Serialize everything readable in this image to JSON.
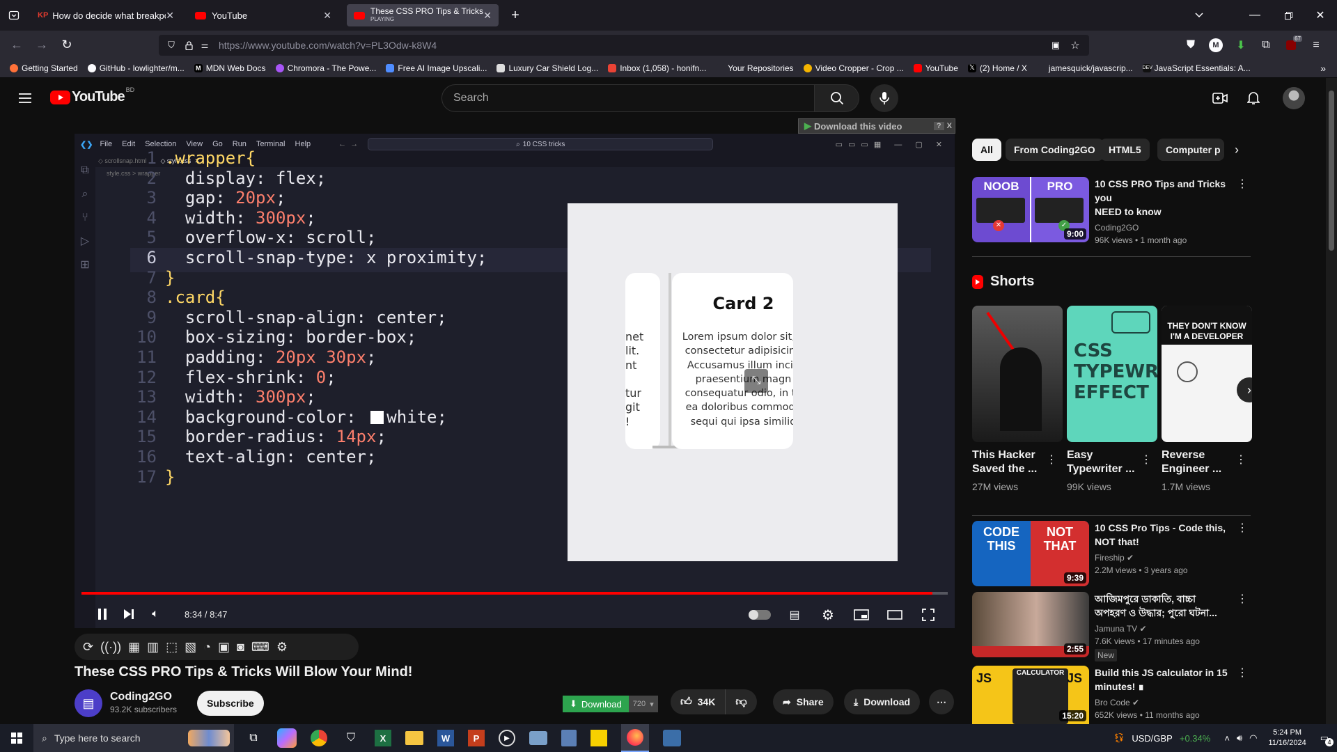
{
  "browser": {
    "tabs": [
      {
        "label": "How do decide what breakpoin",
        "icon": "kp-icon",
        "active": false
      },
      {
        "label": "YouTube",
        "icon": "youtube-icon",
        "active": false
      },
      {
        "label": "These CSS PRO Tips & Tricks W",
        "sub": "PLAYING",
        "icon": "youtube-icon",
        "active": true
      }
    ],
    "url": "https://www.youtube.com/watch?v=PL3Odw-k8W4",
    "extension_badge": "67",
    "bookmarks": [
      "Getting Started",
      "GitHub - lowlighter/m...",
      "MDN Web Docs",
      "Chromora - The Powe...",
      "Free AI Image Upscali...",
      "Luxury Car Shield Log...",
      "Inbox (1,058) - honifn...",
      "Your Repositories",
      "Video Cropper - Crop ...",
      "YouTube",
      "(2) Home / X",
      "jamesquick/javascrip...",
      "JavaScript Essentials: A..."
    ]
  },
  "youtube": {
    "logo_text": "YouTube",
    "region": "BD",
    "search_placeholder": "Search",
    "download_banner": "Download this video",
    "download_banner_help": "?",
    "download_banner_close": "X"
  },
  "video": {
    "editor_menu": [
      "File",
      "Edit",
      "Selection",
      "View",
      "Go",
      "Run",
      "Terminal",
      "Help"
    ],
    "command_center": "10 CSS tricks",
    "editor_tabs": [
      "scrollsnap.html",
      "style.css"
    ],
    "breadcrumb": "style.css > wrapper",
    "code_lines": [
      {
        "n": "1",
        "parts": [
          [
            ".wrapper",
            "kw"
          ],
          [
            "{",
            "br"
          ]
        ]
      },
      {
        "n": "2",
        "parts": [
          [
            "  display: flex;",
            ""
          ]
        ]
      },
      {
        "n": "3",
        "parts": [
          [
            "  gap: ",
            ""
          ],
          [
            "20px",
            "num"
          ],
          [
            ";",
            ""
          ]
        ]
      },
      {
        "n": "4",
        "parts": [
          [
            "  width: ",
            ""
          ],
          [
            "300px",
            "num"
          ],
          [
            ";",
            ""
          ]
        ]
      },
      {
        "n": "5",
        "parts": [
          [
            "  overflow-x: scroll;",
            ""
          ]
        ]
      },
      {
        "n": "6",
        "parts": [
          [
            "  scroll-snap-type: x proximity;",
            ""
          ]
        ]
      },
      {
        "n": "7",
        "parts": [
          [
            "}",
            "br"
          ]
        ]
      },
      {
        "n": "8",
        "parts": [
          [
            ".card",
            "kw"
          ],
          [
            "{",
            "br"
          ]
        ]
      },
      {
        "n": "9",
        "parts": [
          [
            "  scroll-snap-align: center;",
            ""
          ]
        ]
      },
      {
        "n": "10",
        "parts": [
          [
            "  box-sizing: border-box;",
            ""
          ]
        ]
      },
      {
        "n": "11",
        "parts": [
          [
            "  padding: ",
            ""
          ],
          [
            "20px 30px",
            "num"
          ],
          [
            ";",
            ""
          ]
        ]
      },
      {
        "n": "12",
        "parts": [
          [
            "  flex-shrink: ",
            ""
          ],
          [
            "0",
            "num"
          ],
          [
            ";",
            ""
          ]
        ]
      },
      {
        "n": "13",
        "parts": [
          [
            "  width: ",
            ""
          ],
          [
            "300px",
            "num"
          ],
          [
            ";",
            ""
          ]
        ]
      },
      {
        "n": "14",
        "parts": [
          [
            "  background-color: ",
            ""
          ],
          [
            "  ",
            "swatch"
          ],
          [
            "white;",
            ""
          ]
        ]
      },
      {
        "n": "15",
        "parts": [
          [
            "  border-radius: ",
            ""
          ],
          [
            "14px",
            "num"
          ],
          [
            ";",
            ""
          ]
        ]
      },
      {
        "n": "16",
        "parts": [
          [
            "  text-align: center;",
            ""
          ]
        ]
      },
      {
        "n": "17",
        "parts": [
          [
            "}",
            "br"
          ]
        ]
      }
    ],
    "preview": {
      "card_title": "Card 2",
      "card_lines": [
        "Lorem ipsum dolor sit, a",
        "consectetur adipisicing",
        "Accusamus illum incid",
        "praesentium magn",
        "consequatur odio, in te",
        "ea doloribus commodi,",
        "sequi qui ipsa similiq"
      ],
      "prev_card_fragments": [
        "net",
        "lit.",
        "nt",
        "",
        "tur",
        "git",
        "!"
      ]
    },
    "time": "8:34 / 8:47",
    "progress": 0.982
  },
  "below": {
    "title": "These CSS PRO Tips & Tricks Will Blow Your Mind!",
    "channel": "Coding2GO",
    "subscribers": "93.2K subscribers",
    "subscribe": "Subscribe",
    "download_green": "Download",
    "quality": "720",
    "likes": "34K",
    "share": "Share",
    "download": "Download"
  },
  "sidebar": {
    "chips": [
      "All",
      "From Coding2GO",
      "HTML5",
      "Computer p"
    ],
    "top_video": {
      "title_1": "10 CSS PRO Tips and Tricks you",
      "title_2": "NEED to know",
      "channel": "Coding2GO",
      "meta": "96K views • 1 month ago",
      "duration": "9:00",
      "thumb_left": "NOOB",
      "thumb_right": "PRO"
    },
    "shorts_heading": "Shorts",
    "shorts": [
      {
        "title_1": "This Hacker",
        "title_2": "Saved the ...",
        "views": "27M views"
      },
      {
        "title_1": "Easy",
        "title_2": "Typewriter ...",
        "views": "99K views",
        "thumb_text": "CSS TYPEWRITER EFFECT"
      },
      {
        "title_1": "Reverse",
        "title_2": "Engineer ...",
        "views": "1.7M views",
        "thumb_text": "THEY DON'T KNOW I'M A DEVELOPER"
      }
    ],
    "videos": [
      {
        "title_1": "10 CSS Pro Tips - Code this,",
        "title_2": "NOT that!",
        "channel": "Fireship",
        "meta": "2.2M views • 3 years ago",
        "duration": "9:39",
        "badge": "",
        "thumb_a": "CODE THIS",
        "thumb_b": "NOT THAT"
      },
      {
        "title_1": "আজিমপুরে ডাকাতি, বাচ্চা",
        "title_2": "অপহরণ ও উদ্ধার; পুরো ঘটনা...",
        "channel": "Jamuna TV",
        "meta": "7.6K views • 17 minutes ago",
        "duration": "2:55",
        "badge": "New",
        "thumb_a": "",
        "thumb_b": ""
      },
      {
        "title_1": "Build this JS calculator in 15",
        "title_2": "minutes! ∎",
        "channel": "Bro Code",
        "meta": "652K views • 11 months ago",
        "duration": "15:20",
        "badge": "",
        "thumb_a": "JS",
        "thumb_b": "CALCULATOR"
      }
    ]
  },
  "taskbar": {
    "search_placeholder": "Type here to search",
    "stock": "USD/GBP",
    "stock_change": "+0.34%",
    "time": "5:24 PM",
    "date": "11/16/2024",
    "notif": "4"
  }
}
